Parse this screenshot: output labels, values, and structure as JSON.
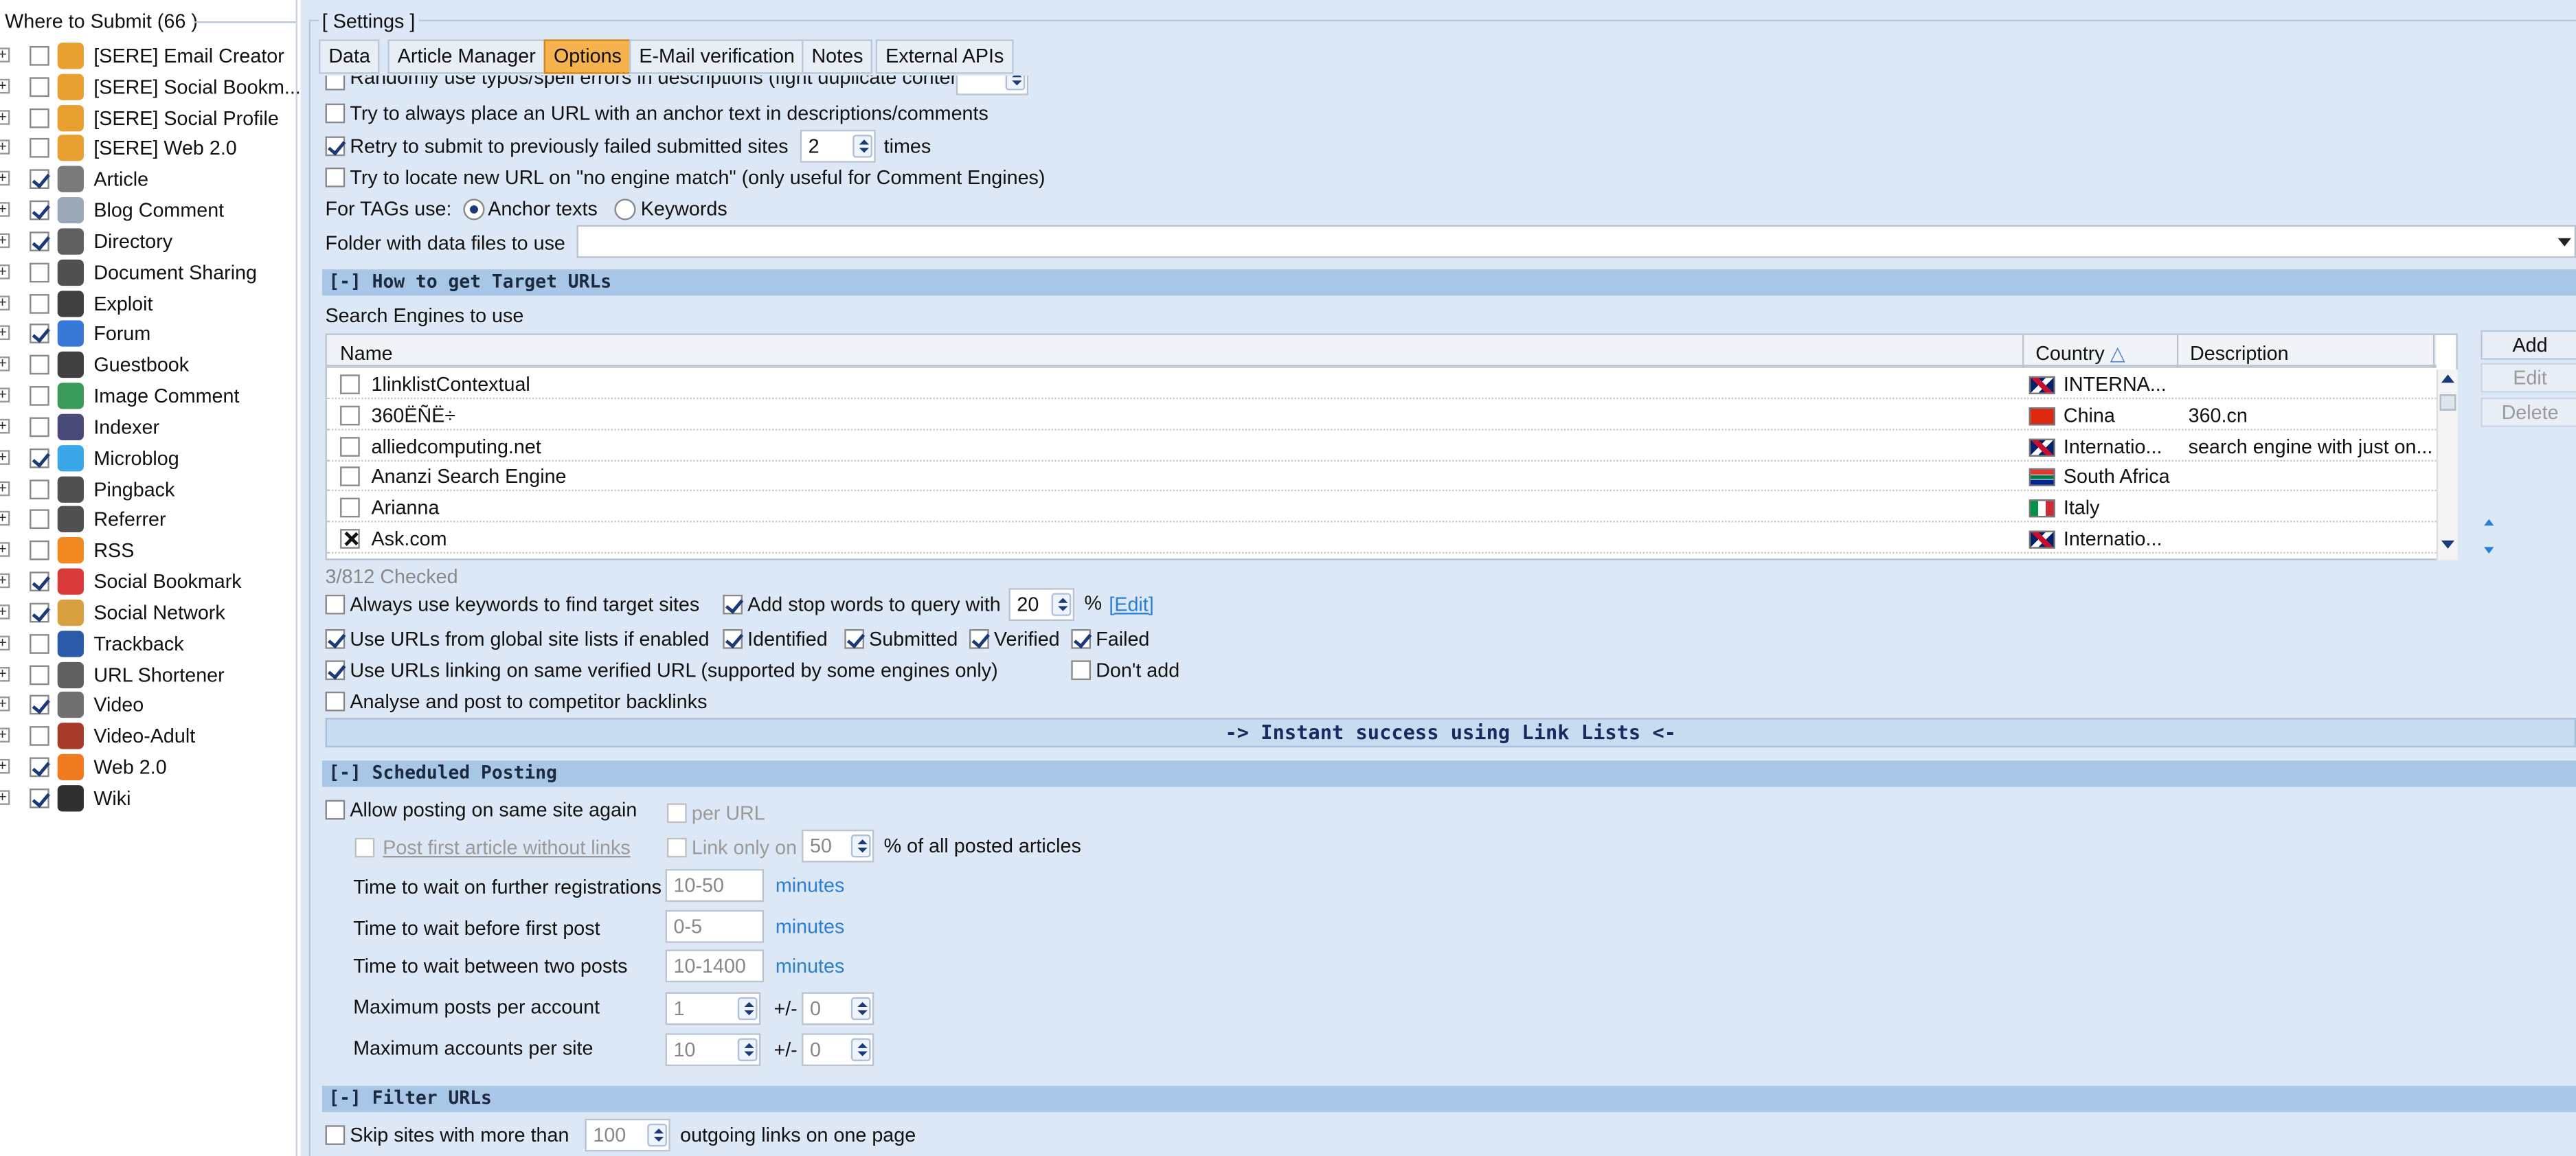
{
  "left_panel": {
    "title": "Where to Submit",
    "count": "(66 )",
    "items": [
      {
        "label": "[SERE] Email Creator",
        "checked": false,
        "icon": "gear-icon",
        "color": "#e8a030"
      },
      {
        "label": "[SERE] Social Bookm...",
        "checked": false,
        "icon": "gear-icon",
        "color": "#e8a030"
      },
      {
        "label": "[SERE] Social Profile",
        "checked": false,
        "icon": "gear-icon",
        "color": "#e8a030"
      },
      {
        "label": "[SERE] Web 2.0",
        "checked": false,
        "icon": "gear-icon",
        "color": "#e8a030"
      },
      {
        "label": "Article",
        "checked": true,
        "icon": "document-icon",
        "color": "#7a7a7a"
      },
      {
        "label": "Blog Comment",
        "checked": true,
        "icon": "comment-icon",
        "color": "#9aa8b8"
      },
      {
        "label": "Directory",
        "checked": true,
        "icon": "directory-icon",
        "color": "#606060"
      },
      {
        "label": "Document Sharing",
        "checked": false,
        "icon": "folder-icon",
        "color": "#505050"
      },
      {
        "label": "Exploit",
        "checked": false,
        "icon": "exploit-icon",
        "color": "#404040"
      },
      {
        "label": "Forum",
        "checked": true,
        "icon": "forum-icon",
        "color": "#3a78d8"
      },
      {
        "label": "Guestbook",
        "checked": false,
        "icon": "book-icon",
        "color": "#404040"
      },
      {
        "label": "Image Comment",
        "checked": false,
        "icon": "image-icon",
        "color": "#3a9a5a"
      },
      {
        "label": "Indexer",
        "checked": false,
        "icon": "indexer-icon",
        "color": "#4a4a7a"
      },
      {
        "label": "Microblog",
        "checked": true,
        "icon": "twitter-icon",
        "color": "#3aa8e8"
      },
      {
        "label": "Pingback",
        "checked": false,
        "icon": "pingback-icon",
        "color": "#505050"
      },
      {
        "label": "Referrer",
        "checked": false,
        "icon": "referrer-icon",
        "color": "#505050"
      },
      {
        "label": "RSS",
        "checked": false,
        "icon": "rss-icon",
        "color": "#f08a20"
      },
      {
        "label": "Social Bookmark",
        "checked": true,
        "icon": "heart-icon",
        "color": "#d83a3a"
      },
      {
        "label": "Social Network",
        "checked": true,
        "icon": "people-icon",
        "color": "#d8a040"
      },
      {
        "label": "Trackback",
        "checked": false,
        "icon": "trackback-icon",
        "color": "#2a5aa8"
      },
      {
        "label": "URL Shortener",
        "checked": false,
        "icon": "chevrons-icon",
        "color": "#606060"
      },
      {
        "label": "Video",
        "checked": true,
        "icon": "video-icon",
        "color": "#707070"
      },
      {
        "label": "Video-Adult",
        "checked": false,
        "icon": "video-adult-icon",
        "color": "#a83a2a"
      },
      {
        "label": "Web 2.0",
        "checked": true,
        "icon": "blogger-icon",
        "color": "#f07a20"
      },
      {
        "label": "Wiki",
        "checked": true,
        "icon": "wiki-icon",
        "color": "#303030"
      }
    ]
  },
  "settings": {
    "group_title": "[ Settings ]",
    "tabs": [
      {
        "label": "Data",
        "active": false
      },
      {
        "label": "Article Manager",
        "active": false
      },
      {
        "label": "Options",
        "active": true
      },
      {
        "label": "E-Mail verification",
        "active": false
      },
      {
        "label": "Notes",
        "active": false
      },
      {
        "label": "External APIs",
        "active": false
      }
    ],
    "top_options": {
      "cut_off_label": "Randomly use typos/spell errors in descriptions (fight duplicate content)",
      "cut_off_value": "",
      "always_anchor": "Try to always place an URL with an anchor text in descriptions/comments",
      "retry_label": "Retry to submit to previously failed submitted sites",
      "retry_value": "2",
      "retry_suffix": "times",
      "locate_new_url": "Try to locate new URL on \"no engine match\" (only useful for Comment Engines)",
      "tags_label": "For TAGs use:",
      "tags_anchor": "Anchor texts",
      "tags_keywords": "Keywords",
      "folder_label": "Folder with  data files to use",
      "folder_value": ""
    },
    "how_to_get": {
      "header": "[-] How to get Target URLs",
      "engines_label": "Search Engines to use",
      "columns": {
        "name": "Name",
        "country": "Country",
        "description": "Description"
      },
      "rows": [
        {
          "name": "1linklistContextual",
          "checked": false,
          "country": "INTERNA...",
          "flag": "uk",
          "description": ""
        },
        {
          "name": "360ËÑË÷",
          "checked": false,
          "country": "China",
          "flag": "cn",
          "description": "360.cn"
        },
        {
          "name": "alliedcomputing.net",
          "checked": false,
          "country": "Internatio...",
          "flag": "uk",
          "description": "search engine with just on..."
        },
        {
          "name": "Ananzi Search Engine",
          "checked": false,
          "country": "South Africa",
          "flag": "za",
          "description": ""
        },
        {
          "name": "Arianna",
          "checked": false,
          "country": "Italy",
          "flag": "it",
          "description": ""
        },
        {
          "name": "Ask.com",
          "checked": true,
          "country": "Internatio...",
          "flag": "uk",
          "description": ""
        }
      ],
      "buttons": {
        "add": "Add",
        "edit": "Edit",
        "delete": "Delete"
      },
      "checked_count": "3/812 Checked",
      "always_keywords": "Always use keywords to find target sites",
      "add_stop_words": "Add stop words to query with",
      "stop_words_value": "20",
      "stop_words_suffix": "%",
      "edit_link": "[Edit]",
      "global_lists": "Use URLs from global site lists if enabled",
      "identified": "Identified",
      "submitted": "Submitted",
      "verified": "Verified",
      "failed": "Failed",
      "same_verified": "Use URLs linking on same verified URL (supported by some engines only)",
      "dont_add": "Don't add",
      "analyse": "Analyse and post to competitor backlinks",
      "instant_success": "-> Instant success using Link Lists <-"
    },
    "scheduled": {
      "header": "[-] Scheduled Posting",
      "allow_same_site": "Allow posting on same site again",
      "per_url": "per URL",
      "post_first": "Post first article without links",
      "link_only_on": "Link only on",
      "link_only_value": "50",
      "link_only_suffix": "% of all posted articles",
      "wait_registrations_label": "Time to wait on further registrations",
      "wait_registrations_value": "10-50",
      "wait_first_post_label": "Time to wait before first post",
      "wait_first_post_value": "0-5",
      "wait_between_label": "Time to wait between two posts",
      "wait_between_value": "10-1400",
      "minutes": "minutes",
      "max_posts_label": "Maximum posts per account",
      "max_posts_value": "1",
      "max_posts_pm": "0",
      "max_accounts_label": "Maximum accounts per site",
      "max_accounts_value": "10",
      "max_accounts_pm": "0",
      "plus_minus": "+/-"
    },
    "filter": {
      "header": "[-] Filter URLs",
      "skip_label": "Skip sites with more than",
      "skip_value": "100",
      "skip_suffix": "outgoing links on one page"
    }
  }
}
